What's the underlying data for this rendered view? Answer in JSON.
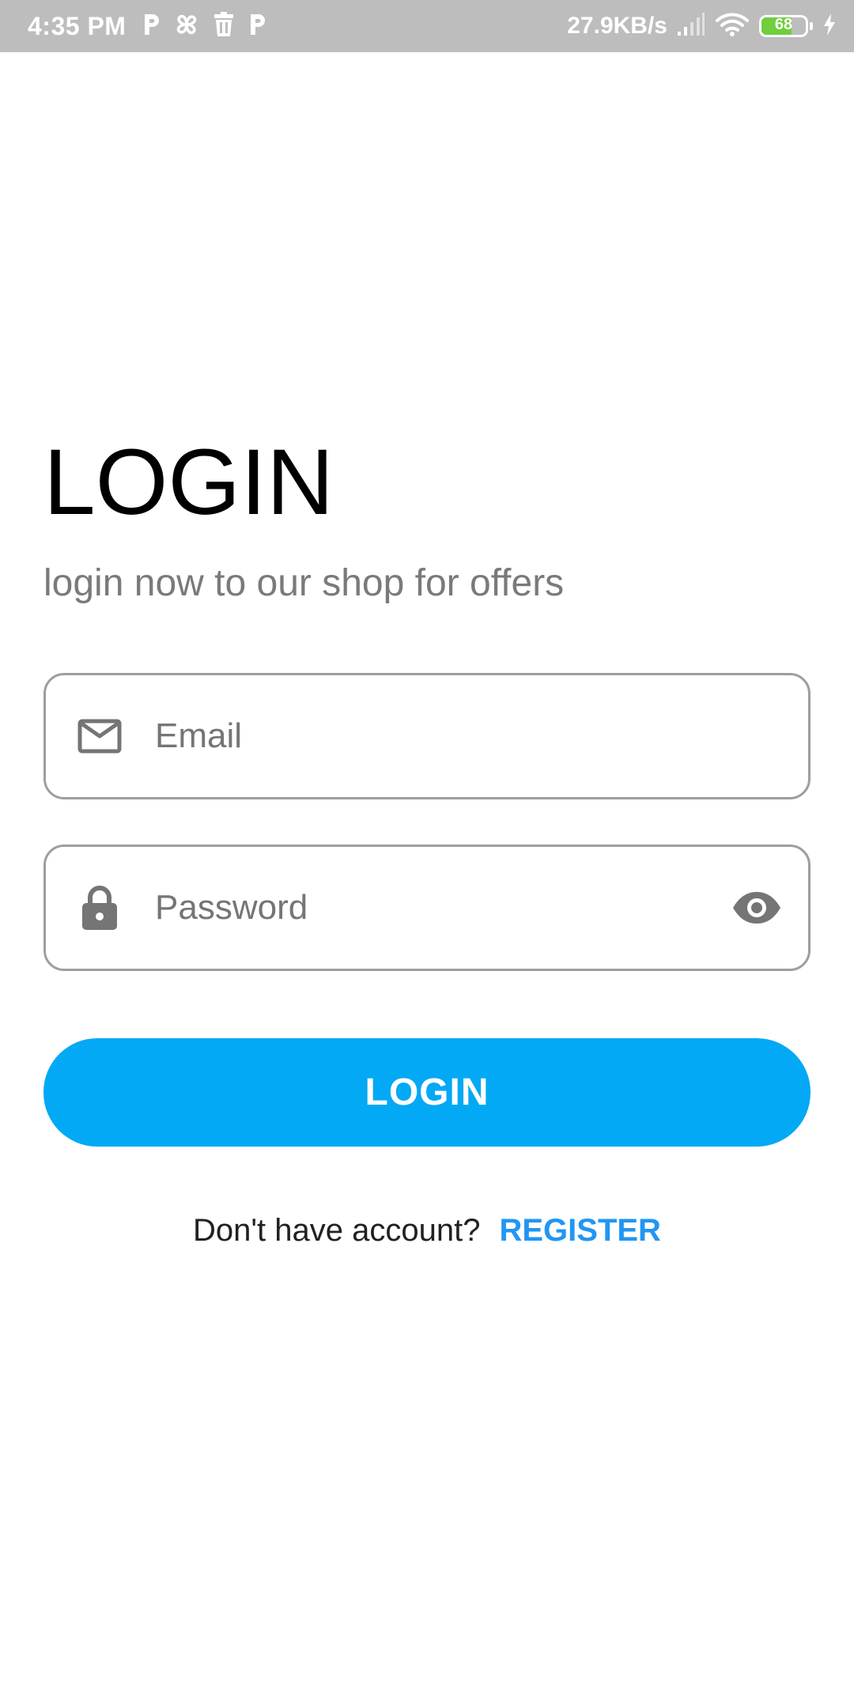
{
  "status_bar": {
    "time": "4:35 PM",
    "net_speed": "27.9KB/s",
    "battery_level": "68",
    "battery_fraction": 0.68,
    "notification_icons": [
      "p-app-icon",
      "pinwheel-icon",
      "trash-icon",
      "p-app-icon"
    ]
  },
  "login": {
    "title": "LOGIN",
    "subtitle": "login now to our shop for offers",
    "email_placeholder": "Email",
    "password_placeholder": "Password",
    "button_label": "LOGIN",
    "register_prompt": "Don't have account?",
    "register_link": "REGISTER"
  },
  "colors": {
    "primary": "#03a9f4",
    "link": "#2196f3",
    "status_bar_bg": "#bdbdbd",
    "field_border": "#9e9e9e",
    "icon_gray": "#757575"
  }
}
